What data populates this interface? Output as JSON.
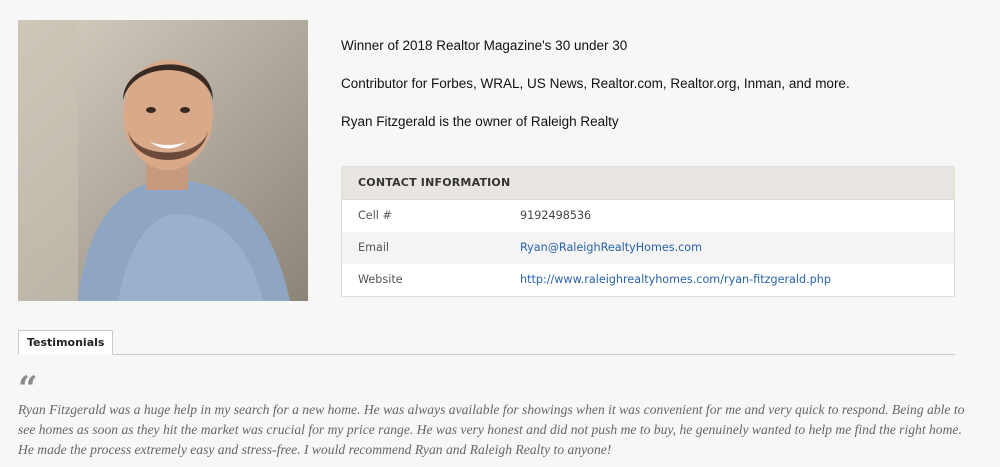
{
  "profile": {
    "photo_alt": "Ryan Fitzgerald headshot"
  },
  "bio": {
    "lines": [
      "Winner of 2018 Realtor Magazine's 30 under 30",
      "Contributor for Forbes, WRAL, US News, Realtor.com, Realtor.org, Inman, and more.",
      "Ryan Fitzgerald is the owner of Raleigh Realty"
    ]
  },
  "contact": {
    "header": "CONTACT INFORMATION",
    "rows": [
      {
        "label": "Cell #",
        "value": "9192498536"
      },
      {
        "label": "Email",
        "value": "Ryan@RaleighRealtyHomes.com"
      },
      {
        "label": "Website",
        "value": "http://www.raleighrealtyhomes.com/ryan-fitzgerald.php"
      }
    ]
  },
  "tabs": {
    "active": "Testimonials"
  },
  "testimonial": {
    "quote_mark": "“",
    "text": "Ryan Fitzgerald was a huge help in my search for a new home. He was always available for showings when it was convenient for me and very quick to respond. Being able to see homes as soon as they hit the market was crucial for my price range. He was very honest and did not push me to buy, he genuinely wanted to help me find the right home. He made the process extremely easy and stress-free. I would recommend Ryan and Raleigh Realty to anyone!"
  },
  "colors": {
    "link": "#2a62a8",
    "contact_header_bg": "#e9e6e1"
  }
}
